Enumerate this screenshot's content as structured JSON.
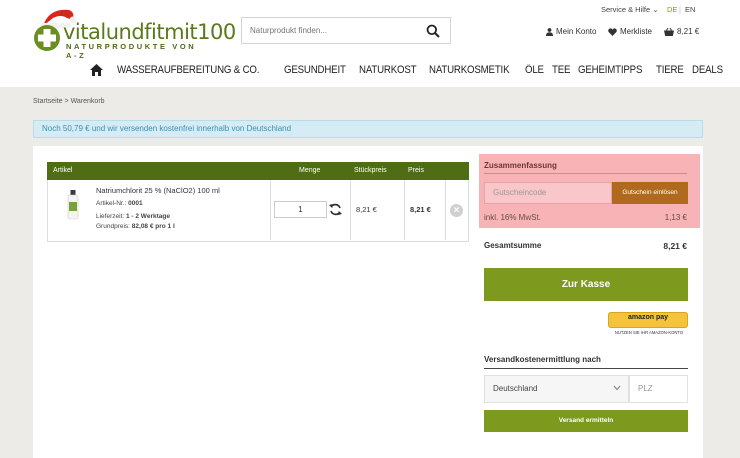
{
  "logo": {
    "brand": "vitalundfitmit100",
    "tagline": "NATURPRODUKTE VON A-Z"
  },
  "topbar": {
    "service": "Service & Hilfe",
    "lang_de": "DE",
    "lang_sep": "|",
    "lang_en": "EN"
  },
  "search": {
    "placeholder": "Naturprodukt finden..."
  },
  "actions": {
    "account": "Mein Konto",
    "wishlist": "Merkliste",
    "cart": "8,21 €"
  },
  "nav": [
    "WASSERAUFBEREITUNG & CO.",
    "GESUNDHEIT",
    "NATURKOST",
    "NATURKOSMETIK",
    "ÖLE",
    "TEE",
    "GEHEIMTIPPS",
    "TIERE",
    "DEALS"
  ],
  "breadcrumb": {
    "home": "Startseite",
    "sep": ">",
    "current": "Warenkorb"
  },
  "banner": "Noch 50,79 € und wir versenden kostenfrei innerhalb von Deutschland",
  "cart": {
    "headers": {
      "article": "Artikel",
      "quantity": "Menge",
      "unit_price": "Stückpreis",
      "price": "Preis"
    },
    "item": {
      "name": "Natriumchlorit 25 % (NaClO2) 100 ml",
      "artno_label": "Artikel-Nr.:",
      "artno": "0001",
      "delivery_label": "Lieferzeit:",
      "delivery": "1 - 2 Werktage",
      "baseprice_label": "Grundpreis:",
      "baseprice": "82,08 € pro 1 l",
      "quantity": "1",
      "unit_price": "8,21 €",
      "price": "8,21 €"
    }
  },
  "summary": {
    "title": "Zusammenfassung",
    "voucher_placeholder": "Gutscheincode",
    "voucher_button": "Gutschein einlösen",
    "tax_label": "inkl. 16% MwSt.",
    "tax_value": "1,13 €",
    "total_label": "Gesamtsumme",
    "total_value": "8,21 €",
    "checkout": "Zur Kasse"
  },
  "amazon": {
    "label": "amazon pay",
    "sub": "NUTZEN SIE IHR AMAZON-KONTO"
  },
  "shipping_calc": {
    "title": "Versandkostenermittlung nach",
    "country": "Deutschland",
    "zip_placeholder": "PLZ",
    "button": "Versand ermitteln"
  },
  "colors": {
    "nav_green": "#4f6d14",
    "button_green": "#7e9a1e",
    "summary_bg": "#f7b3b6",
    "voucher_button": "#b06a1e",
    "banner_bg": "#d5ecf5"
  }
}
